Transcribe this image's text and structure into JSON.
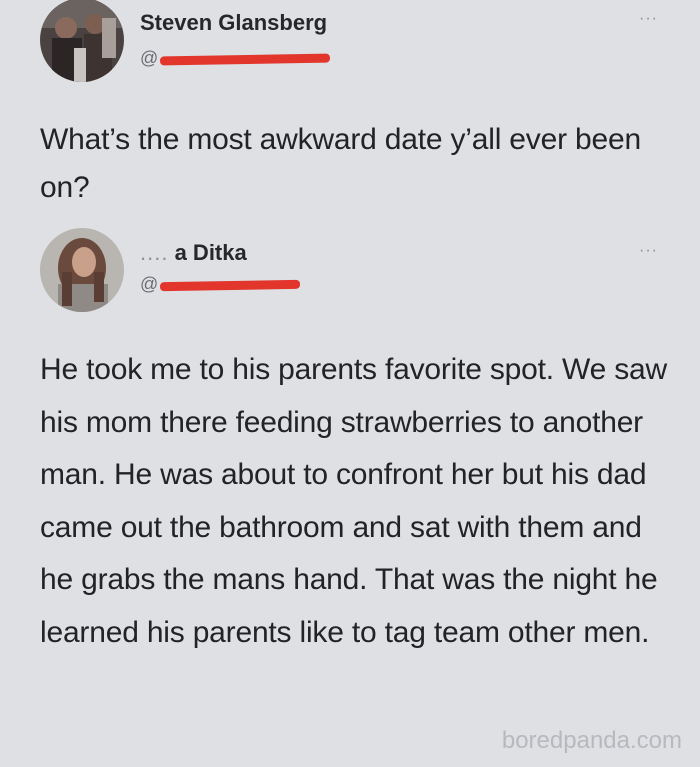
{
  "tweets": [
    {
      "display_name": "Steven Glansberg",
      "handle_prefix": "@",
      "more_glyph": "···",
      "text": "What’s the most awkward date y’all ever been on?"
    },
    {
      "display_name_prefix": "....",
      "display_name": "a Ditka",
      "handle_prefix": "@",
      "more_glyph": "···",
      "text": "He took me to his parents favorite spot. We saw his mom there feeding strawberries to another man. He was about to confront her but his dad came out the bathroom and sat with them and he grabs the mans hand. That was the night he learned his parents like to tag team other men."
    }
  ],
  "watermark": "boredpanda.com",
  "colors": {
    "background": "#dfe0e3",
    "text": "#222327",
    "redaction": "#e2352b",
    "watermark": "#b7b9be"
  }
}
